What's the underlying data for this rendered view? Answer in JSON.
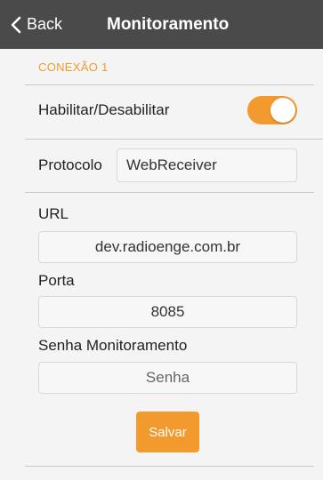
{
  "navbar": {
    "back_label": "Back",
    "title": "Monitoramento"
  },
  "section": {
    "header": "CONEXÃO 1"
  },
  "toggle_row": {
    "label": "Habilitar/Desabilitar",
    "enabled": true
  },
  "protocol": {
    "label": "Protocolo",
    "value": "WebReceiver"
  },
  "url": {
    "label": "URL",
    "value": "dev.radioenge.com.br"
  },
  "port": {
    "label": "Porta",
    "value": "8085"
  },
  "password": {
    "label": "Senha Monitoramento",
    "placeholder": "Senha"
  },
  "actions": {
    "save_label": "Salvar"
  },
  "colors": {
    "accent": "#f39a2e",
    "navbar": "#4a4a4a",
    "background": "#f4f4f4"
  }
}
